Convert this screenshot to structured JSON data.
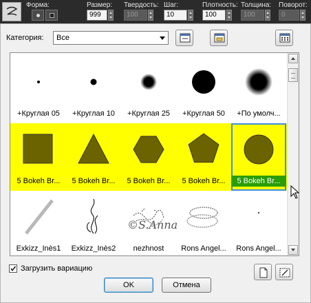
{
  "toolbar": {
    "forma_label": "Форма:",
    "size_label": "Размер:",
    "size_value": "999",
    "hardness_label": "Твердость:",
    "hardness_value": "100",
    "step_label": "Шаг:",
    "step_value": "10",
    "density_label": "Плотность:",
    "density_value": "100",
    "thickness_label": "Толщина:",
    "thickness_value": "100",
    "rotation_label": "Поворот:",
    "rotation_value": "0"
  },
  "dialog": {
    "category_label": "Категория:",
    "category_value": "Все",
    "load_variation_label": "Загрузить вариацию",
    "load_variation_checked": true,
    "ok_label": "OK",
    "cancel_label": "Отмена"
  },
  "brushes": [
    {
      "caption": "+Круглая 05",
      "kind": "dot",
      "size": 2,
      "soft": false
    },
    {
      "caption": "+Круглая 10",
      "kind": "dot",
      "size": 4.5,
      "soft": false
    },
    {
      "caption": "+Круглая 25",
      "kind": "dot",
      "size": 12,
      "soft": true
    },
    {
      "caption": "+Круглая 50",
      "kind": "dot",
      "size": 17,
      "soft": false
    },
    {
      "caption": "+По умолч...",
      "kind": "dot",
      "size": 20,
      "soft": true
    },
    {
      "caption": "5 Bokeh Br...",
      "kind": "square"
    },
    {
      "caption": "5 Bokeh Br...",
      "kind": "triangle"
    },
    {
      "caption": "5 Bokeh Br...",
      "kind": "hexagon"
    },
    {
      "caption": "5 Bokeh Br...",
      "kind": "pentagon"
    },
    {
      "caption": "5 Bokeh Br...",
      "kind": "circle",
      "selected": true
    },
    {
      "caption": "Exkizz_Inès1",
      "kind": "diagonal"
    },
    {
      "caption": "Exkizz_Inès2",
      "kind": "wisp"
    },
    {
      "caption": "nezhnost",
      "kind": "scribble"
    },
    {
      "caption": "Rons Angel...",
      "kind": "halo"
    },
    {
      "caption": "Rons Angel...",
      "kind": "speck"
    }
  ],
  "watermark": "©S.Anna",
  "colors": {
    "highlight_row": "#ffff00",
    "bokeh_fill": "#6b6300",
    "selected_caption_bg": "#2a9d07",
    "selected_outline": "#3c8fe0"
  },
  "icons": {
    "toolbar_brush": "brush-preset-icon",
    "preview_button": "brush-preview-icon",
    "folder_button": "folder-icon",
    "grid_button": "grid-view-icon",
    "add_button": "new-document-icon",
    "delete_button": "edit-brush-icon"
  }
}
